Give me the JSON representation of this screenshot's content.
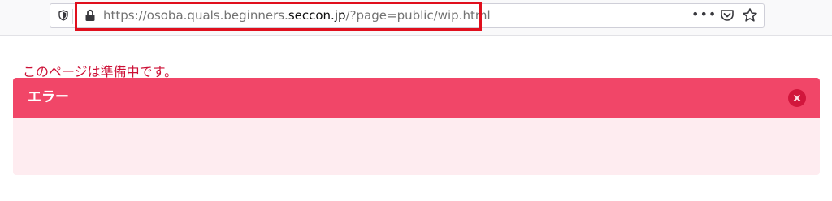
{
  "browser": {
    "url_prefix": "https://osoba.quals.beginners.",
    "url_domain": "seccon.jp",
    "url_suffix": "/?page=public/wip.html",
    "menu_icon": "more-icon",
    "pocket_icon": "pocket-icon",
    "bookmark_icon": "star-icon",
    "highlight_color": "#e00f1d"
  },
  "error": {
    "title": "エラー",
    "message": "このページは準備中です。",
    "header_color": "#f14668",
    "body_color": "#feecf0",
    "text_color": "#cc0f35"
  }
}
